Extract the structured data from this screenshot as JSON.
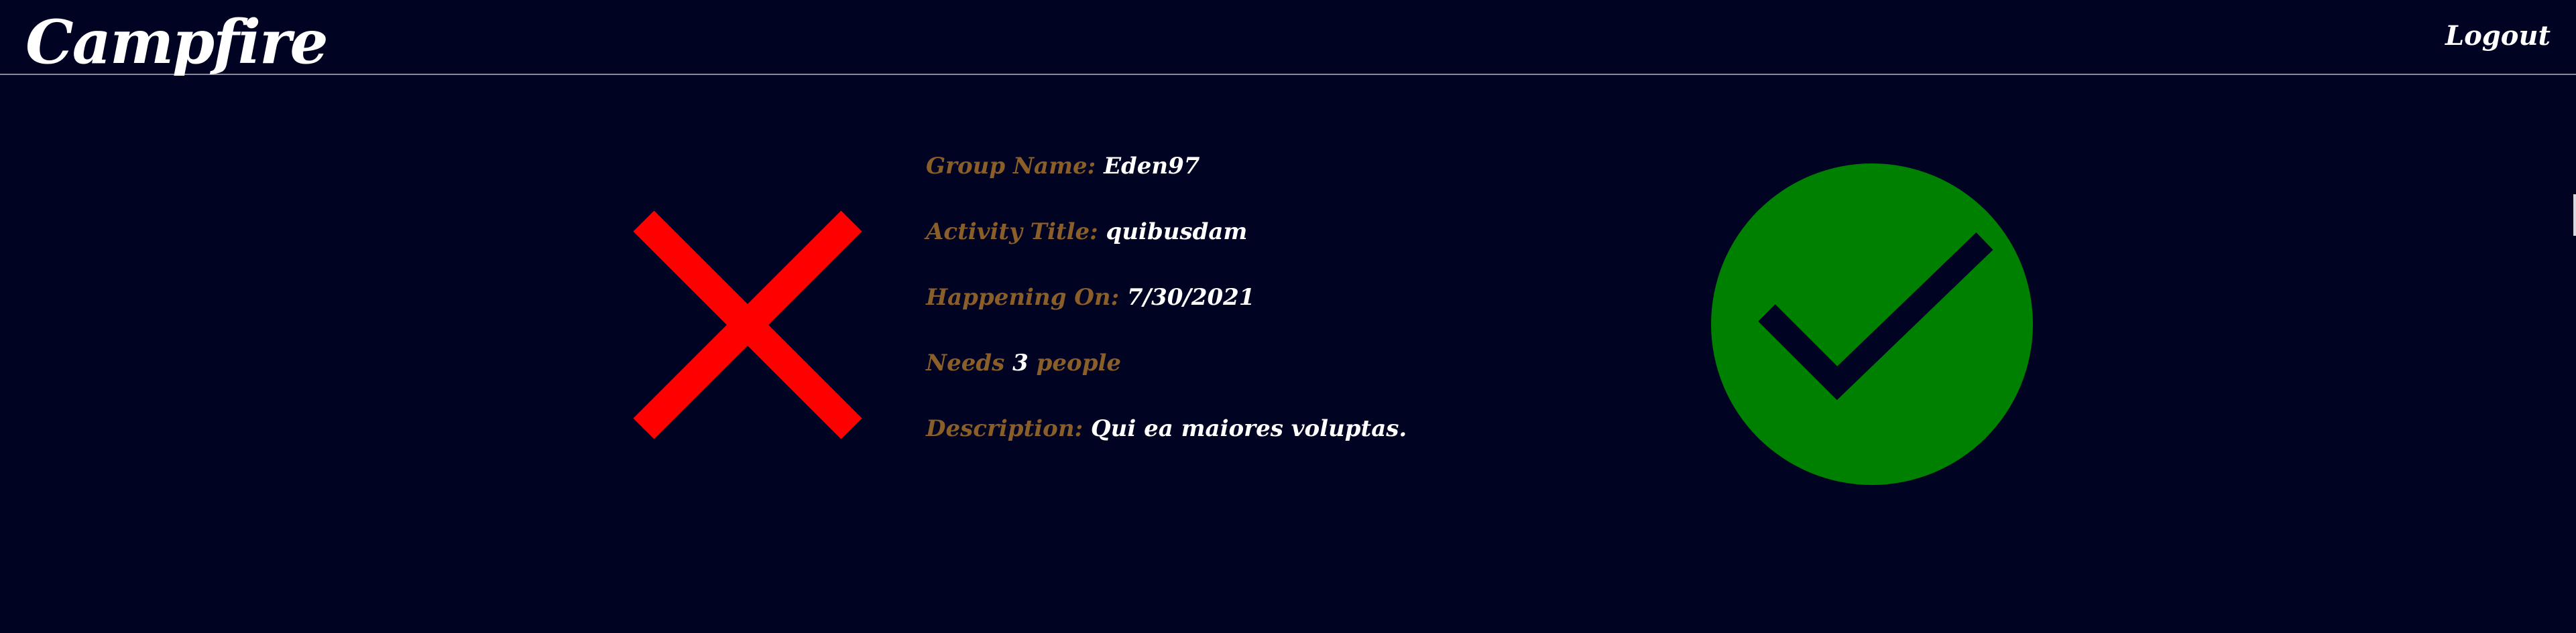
{
  "header": {
    "brand": "Campfire",
    "logout_label": "Logout"
  },
  "activity": {
    "group_name_label": "Group Name:",
    "group_name": "Eden97",
    "activity_title_label": "Activity Title:",
    "activity_title": "quibusdam",
    "happening_on_label": "Happening On:",
    "happening_on": "7/30/2021",
    "needs_prefix": "Needs",
    "needs_count": "3",
    "needs_suffix": "people",
    "description_label": "Description:",
    "description": "Qui ea maiores voluptas."
  },
  "actions": {
    "reject_icon": "close-icon",
    "accept_icon": "checkmark-icon"
  },
  "colors": {
    "background": "#000322",
    "label": "#8a5e28",
    "value": "#ffffff",
    "reject": "#ff0000",
    "accept": "#008000"
  }
}
